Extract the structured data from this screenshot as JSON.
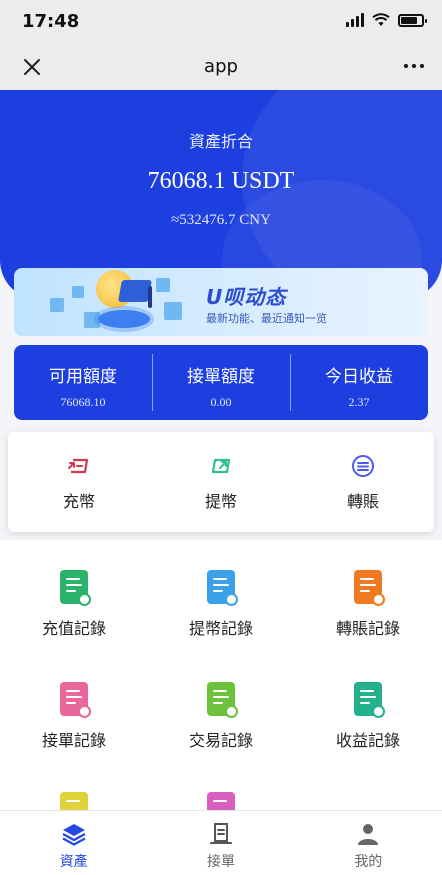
{
  "status_bar": {
    "time": "17:48"
  },
  "nav": {
    "title": "app"
  },
  "hero": {
    "label": "資產折合",
    "amount": "76068.1 USDT",
    "cny": "≈532476.7 CNY"
  },
  "banner": {
    "title": "U呗动态",
    "subtitle": "最新功能、最近通知一览"
  },
  "stats": [
    {
      "label": "可用額度",
      "value": "76068.10"
    },
    {
      "label": "接單額度",
      "value": "0.00"
    },
    {
      "label": "今日收益",
      "value": "2.37"
    }
  ],
  "actions": [
    {
      "label": "充幣",
      "icon": "deposit-icon",
      "color": "#d6384f"
    },
    {
      "label": "提幣",
      "icon": "withdraw-icon",
      "color": "#2fbf8f"
    },
    {
      "label": "轉賬",
      "icon": "transfer-icon",
      "color": "#4a5cf0"
    }
  ],
  "grid": [
    {
      "label": "充值記錄",
      "icon": "deposit-record-icon",
      "color": "#2bb36b"
    },
    {
      "label": "提幣記錄",
      "icon": "withdraw-record-icon",
      "color": "#3aa0e8"
    },
    {
      "label": "轉賬記錄",
      "icon": "transfer-record-icon",
      "color": "#f07a22"
    },
    {
      "label": "接單記錄",
      "icon": "order-record-icon",
      "color": "#e9679a"
    },
    {
      "label": "交易記錄",
      "icon": "trade-record-icon",
      "color": "#6cc23a"
    },
    {
      "label": "收益記錄",
      "icon": "income-record-icon",
      "color": "#23b08c"
    },
    {
      "label": "",
      "icon": "record-icon",
      "color": "#e0d23a"
    },
    {
      "label": "",
      "icon": "record-icon",
      "color": "#d95fc0"
    }
  ],
  "tabs": [
    {
      "label": "資產",
      "icon": "assets-icon",
      "active": true
    },
    {
      "label": "接單",
      "icon": "orders-icon",
      "active": false
    },
    {
      "label": "我的",
      "icon": "profile-icon",
      "active": false
    }
  ],
  "colors": {
    "primary": "#1d3fe0",
    "tab_active": "#2447e0"
  }
}
